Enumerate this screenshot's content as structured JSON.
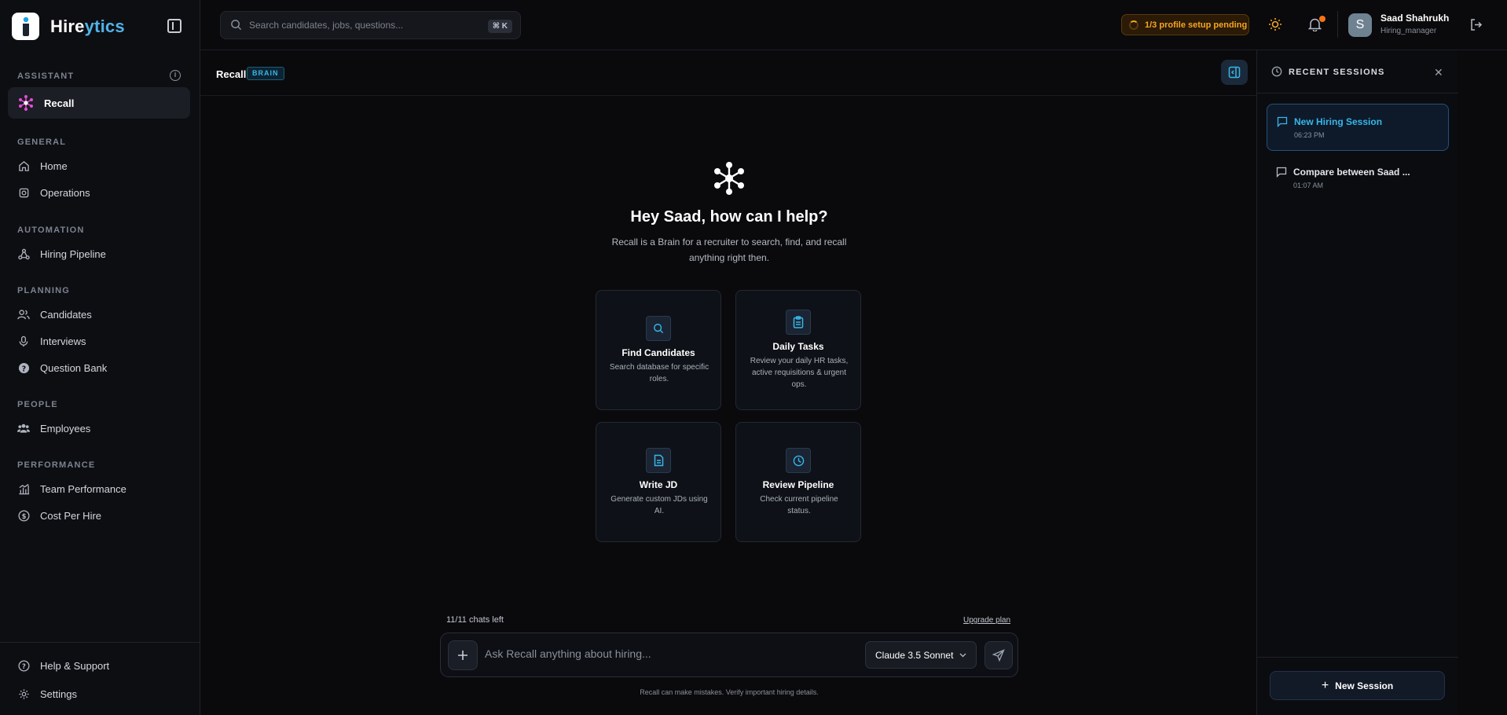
{
  "brand": {
    "name_prefix": "Hire",
    "name_suffix": "ytics"
  },
  "sidebar": {
    "sections": {
      "assistant": "ASSISTANT",
      "general": "GENERAL",
      "automation": "AUTOMATION",
      "planning": "PLANNING",
      "people": "PEOPLE",
      "performance": "PERFORMANCE"
    },
    "items": {
      "recall": "Recall",
      "home": "Home",
      "operations": "Operations",
      "hiring_pipeline": "Hiring Pipeline",
      "candidates": "Candidates",
      "interviews": "Interviews",
      "question_bank": "Question Bank",
      "employees": "Employees",
      "team_performance": "Team Performance",
      "cost_per_hire": "Cost Per Hire",
      "help": "Help & Support",
      "settings": "Settings"
    },
    "active_item": "recall"
  },
  "topbar": {
    "search_placeholder": "Search candidates, jobs, questions...",
    "shortcut": "⌘ K",
    "setup_status": "1/3 profile setup pending",
    "user": {
      "initial": "S",
      "name": "Saad Shahrukh",
      "role": "Hiring_manager"
    }
  },
  "main": {
    "title": "Recall",
    "badge": "BRAIN",
    "greeting": "Hey Saad, how can I help?",
    "subtitle": "Recall is a Brain for a recruiter to search, find, and recall anything right then.",
    "cards": [
      {
        "title": "Find Candidates",
        "desc": "Search database for specific roles.",
        "icon": "search-icon"
      },
      {
        "title": "Daily Tasks",
        "desc": "Review your daily HR tasks, active requisitions & urgent ops.",
        "icon": "clipboard-icon"
      },
      {
        "title": "Write JD",
        "desc": "Generate custom JDs using AI.",
        "icon": "document-icon"
      },
      {
        "title": "Review Pipeline",
        "desc": "Check current pipeline status.",
        "icon": "clock-icon"
      }
    ],
    "chats_left": "11/11 chats left",
    "upgrade_label": "Upgrade plan",
    "composer_placeholder": "Ask Recall anything about hiring...",
    "model": "Claude 3.5 Sonnet",
    "disclaimer": "Recall can make mistakes. Verify important hiring details."
  },
  "sessions_panel": {
    "title": "RECENT SESSIONS",
    "sessions": [
      {
        "name": "New Hiring Session",
        "time": "06:23 PM",
        "active": true
      },
      {
        "name": "Compare between Saad ...",
        "time": "01:07 AM",
        "active": false
      }
    ],
    "new_session_label": "New Session"
  },
  "colors": {
    "accent": "#38b6e8",
    "warning": "#f5a524",
    "notification": "#f97316",
    "recall_pink": "#e64bd8"
  }
}
